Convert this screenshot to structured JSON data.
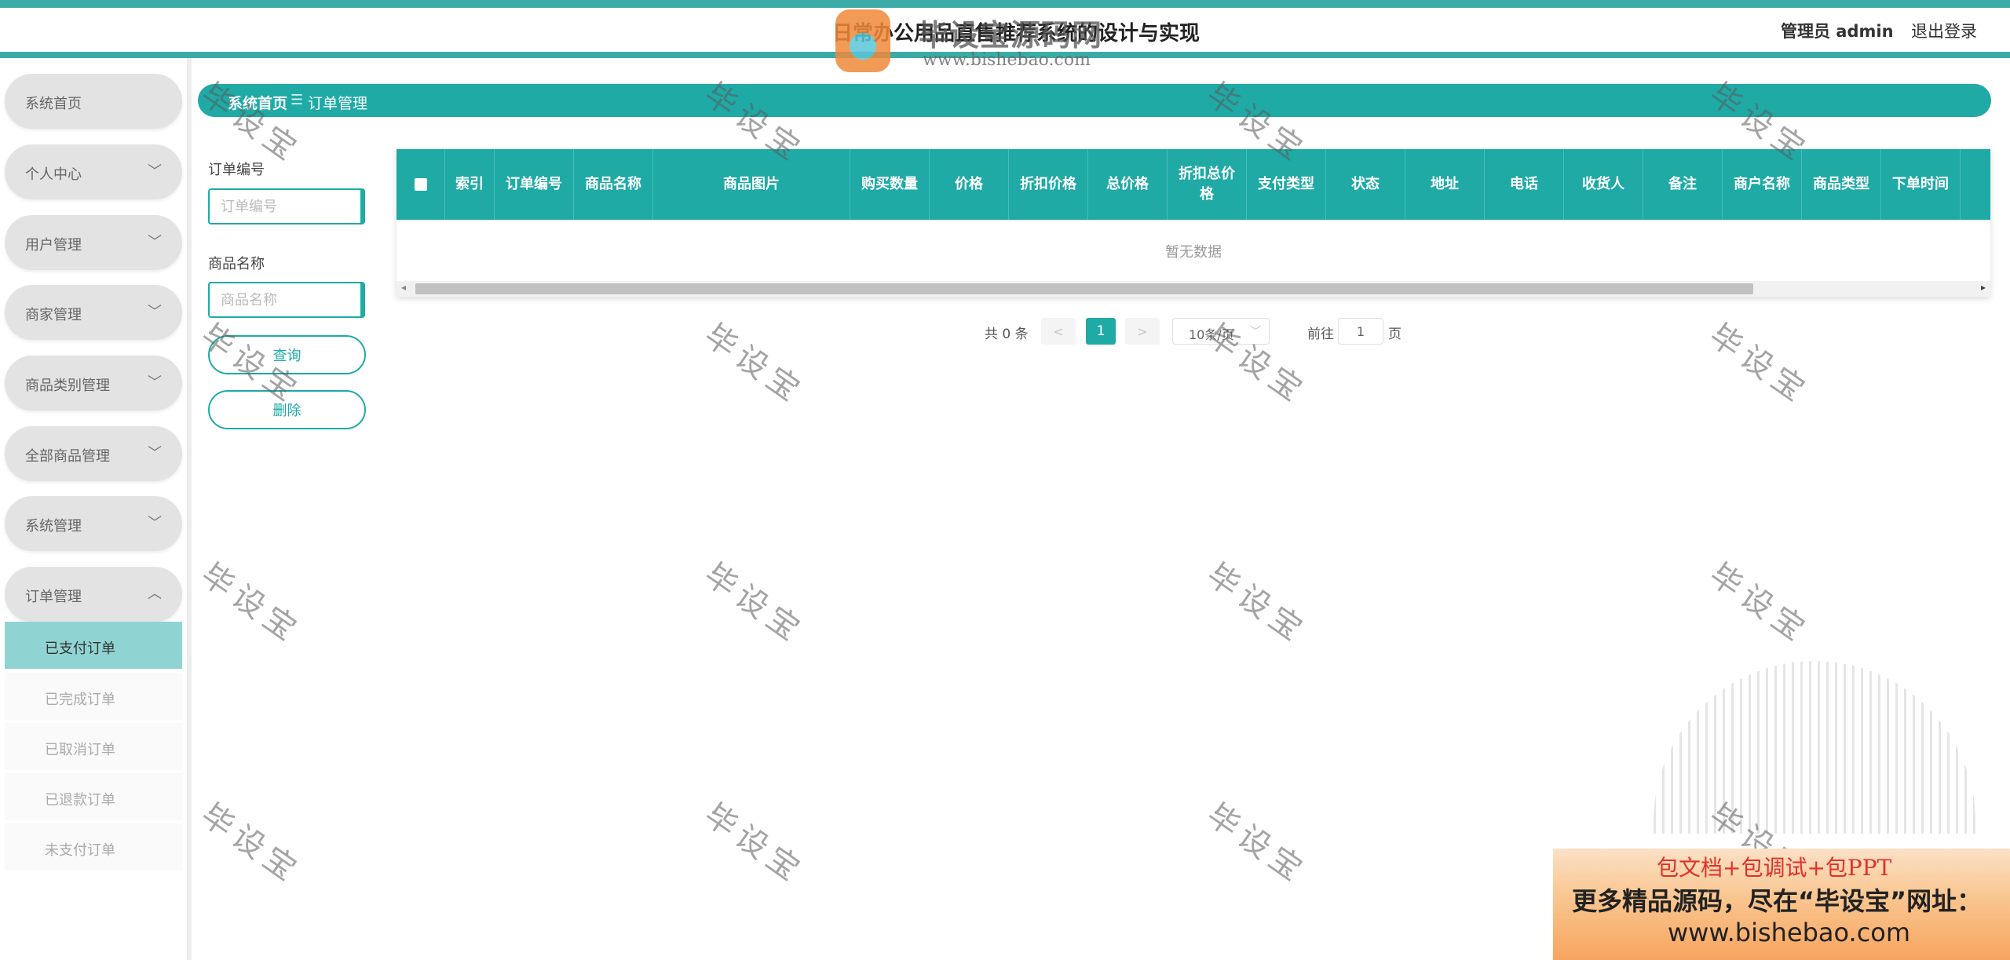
{
  "app": {
    "title": "日常办公用品直售推荐系统的设计与实现",
    "admin_label": "管理员 admin",
    "logout_label": "退出登录",
    "logo_text": "毕设宝源码网",
    "logo_url": "www.bishebao.com"
  },
  "sidebar": {
    "items": [
      {
        "label": "系统首页",
        "chevron": ""
      },
      {
        "label": "个人中心",
        "chevron": "﹀"
      },
      {
        "label": "用户管理",
        "chevron": "﹀"
      },
      {
        "label": "商家管理",
        "chevron": "﹀"
      },
      {
        "label": "商品类别管理",
        "chevron": "﹀"
      },
      {
        "label": "全部商品管理",
        "chevron": "﹀"
      },
      {
        "label": "系统管理",
        "chevron": "﹀"
      },
      {
        "label": "订单管理",
        "chevron": "︿"
      }
    ],
    "submenu": [
      {
        "label": "已支付订单",
        "active": true
      },
      {
        "label": "已完成订单",
        "active": false
      },
      {
        "label": "已取消订单",
        "active": false
      },
      {
        "label": "已退款订单",
        "active": false
      },
      {
        "label": "未支付订单",
        "active": false
      }
    ]
  },
  "breadcrumb": {
    "home": "系统首页",
    "separator": "☰",
    "current": "订单管理"
  },
  "search": {
    "order_no_label": "订单编号",
    "order_no_placeholder": "订单编号",
    "order_no_value": "",
    "product_name_label": "商品名称",
    "product_name_placeholder": "商品名称",
    "product_name_value": "",
    "query_button": "查询",
    "delete_button": "删除"
  },
  "table": {
    "columns": [
      "索引",
      "订单编号",
      "商品名称",
      "商品图片",
      "购买数量",
      "价格",
      "折扣价格",
      "总价格",
      "折扣总价格",
      "支付类型",
      "状态",
      "地址",
      "电话",
      "收货人",
      "备注",
      "商户名称",
      "商品类型",
      "下单时间"
    ],
    "empty_text": "暂无数据"
  },
  "pagination": {
    "total": "共 0 条",
    "prev": "<",
    "current_page": "1",
    "next": ">",
    "page_size": "10条/页",
    "goto_label": "前往",
    "goto_value": "1",
    "page_suffix": "页"
  },
  "watermark": {
    "text": "毕设宝"
  },
  "promo": {
    "line1": "包文档+包调试+包PPT",
    "line2": "更多精品源码，尽在“毕设宝”网址：",
    "line3": "www.bishebao.com"
  },
  "colors": {
    "primary": "#1faaa6",
    "header_stripe": "#3aaba6",
    "submenu_active": "#8fd4d2",
    "menu_bg": "#e3e3e3"
  }
}
